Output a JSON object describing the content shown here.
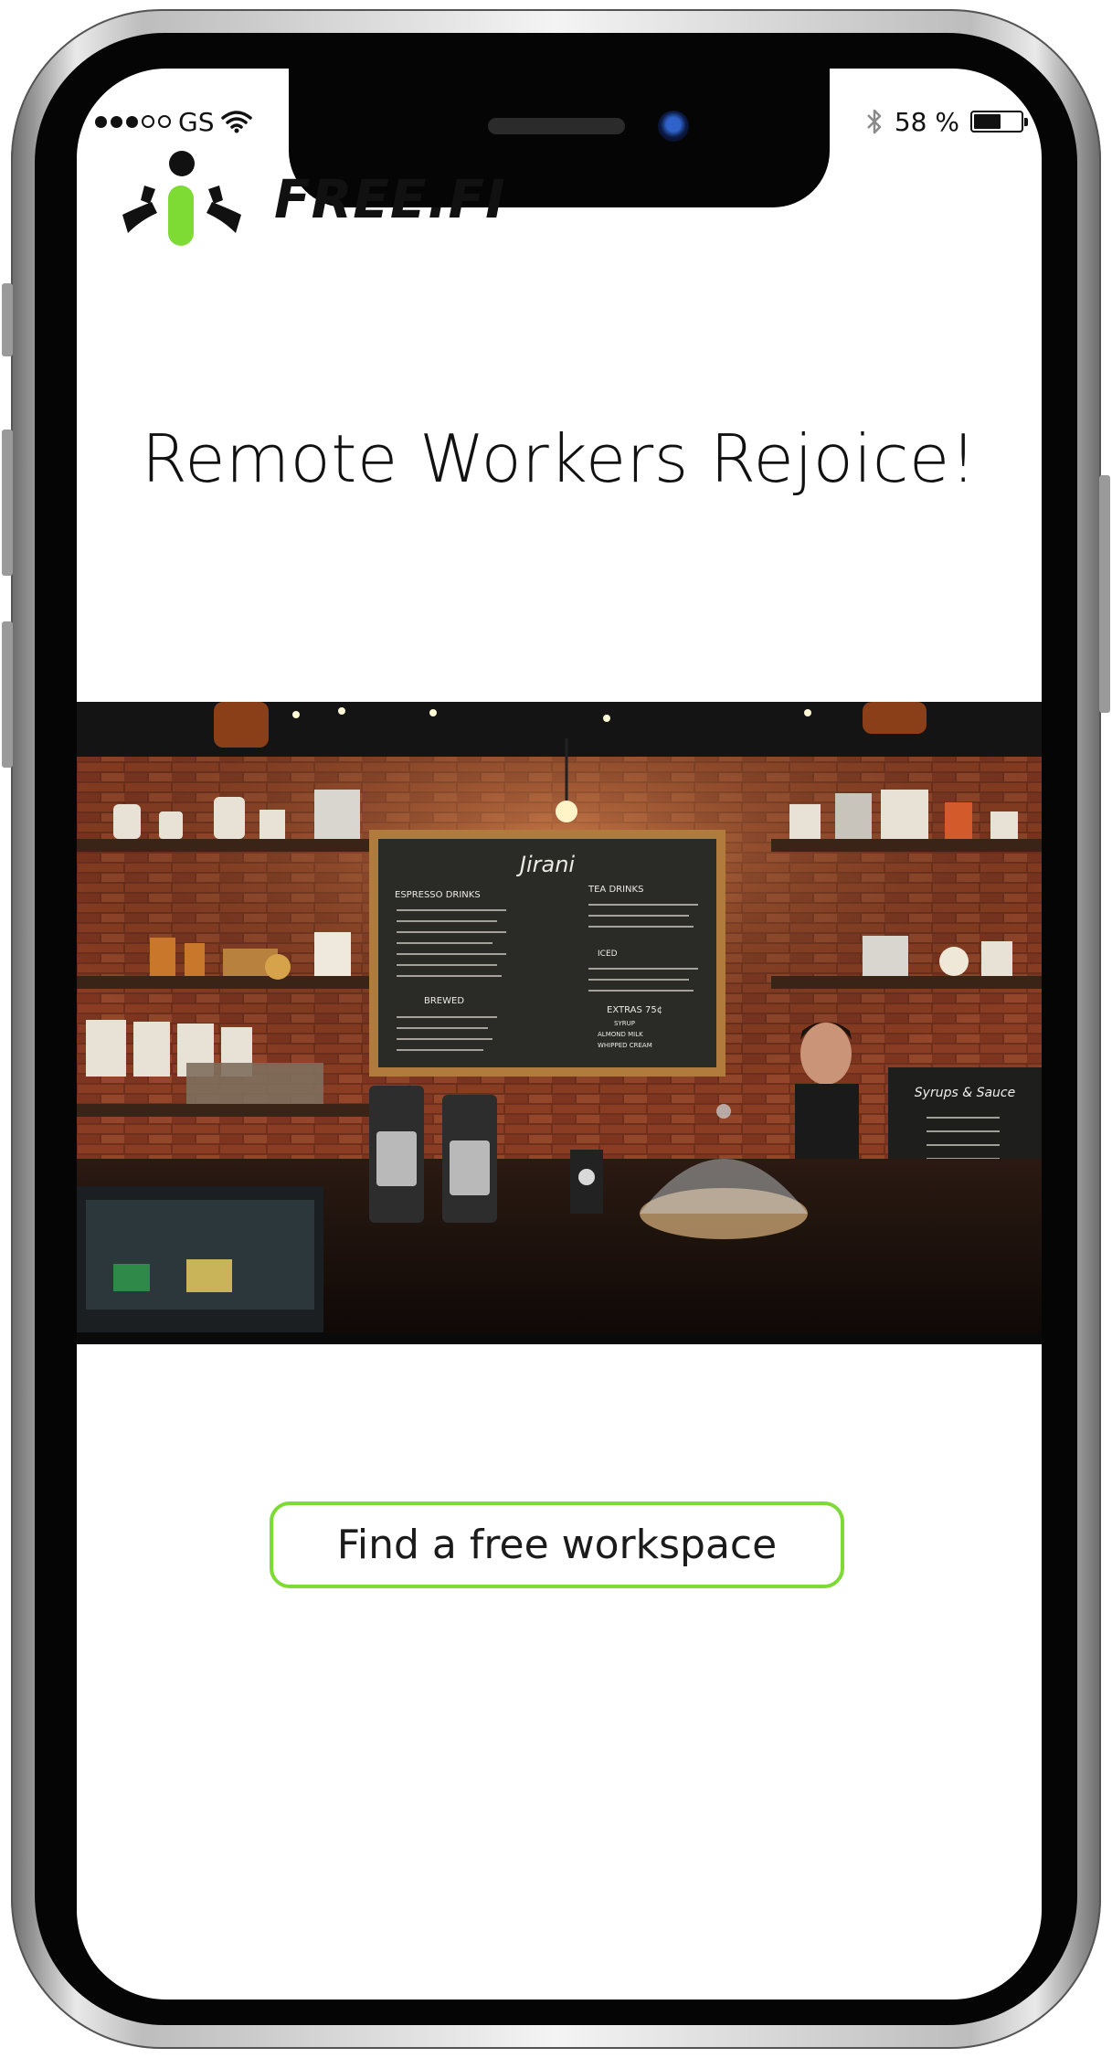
{
  "status_bar": {
    "carrier": "GS",
    "battery_text": "58 %",
    "battery_level_percent": 58,
    "icons": [
      "signal-dots-icon",
      "wifi-icon",
      "bluetooth-icon",
      "battery-icon"
    ]
  },
  "brand": {
    "name": "FREE.FI",
    "accent_color": "#7ddb33",
    "logo_icon": "person-figure-logo"
  },
  "hero": {
    "headline": "Remote Workers Rejoice!",
    "image_subject": "coffee-shop-counter"
  },
  "chalkboard": {
    "sign": "Jirani",
    "left_heading": "ESPRESSO DRINKS",
    "right_heading": "TEA DRINKS",
    "brewed_heading": "BREWED",
    "iced_heading": "ICED",
    "extras_heading": "EXTRAS 75¢",
    "extras_items": [
      "SYRUP",
      "ALMOND MILK",
      "WHIPPED CREAM"
    ],
    "small_board_title": "Syrups & Sauce"
  },
  "cta": {
    "label": "Find a free workspace",
    "border_color": "#7ddb33"
  }
}
